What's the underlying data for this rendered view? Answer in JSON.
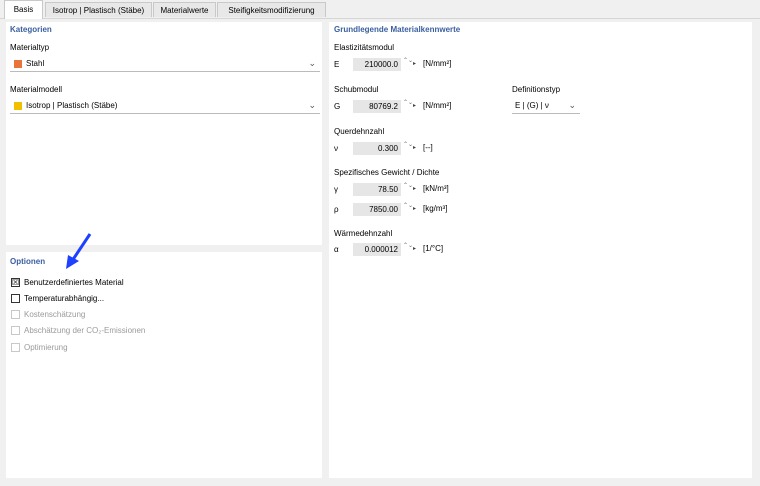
{
  "tabs": [
    "Basis",
    "Isotrop | Plastisch (Stäbe)",
    "Materialwerte",
    "Steifigkeitsmodifizierung"
  ],
  "kategorien": {
    "title": "Kategorien",
    "materialtyp_label": "Materialtyp",
    "materialtyp_value": "Stahl",
    "materialtyp_color": "#e8743b",
    "materialmodell_label": "Materialmodell",
    "materialmodell_value": "Isotrop | Plastisch (Stäbe)",
    "materialmodell_color": "#f0c000"
  },
  "optionen": {
    "title": "Optionen",
    "items": [
      {
        "label": "Benutzerdefiniertes Material",
        "checked": "☒",
        "enabled": true
      },
      {
        "label": "Temperaturabhängig...",
        "checked": "",
        "enabled": true
      },
      {
        "label": "Kostenschätzung",
        "checked": "",
        "enabled": false
      },
      {
        "label": "Abschätzung der CO₂-Emissionen",
        "checked": "",
        "enabled": false
      },
      {
        "label": "Optimierung",
        "checked": "",
        "enabled": false
      }
    ]
  },
  "grund": {
    "title": "Grundlegende Materialkennwerte",
    "e_section": "Elastizitätsmodul",
    "e_sym": "E",
    "e_val": "210000.0",
    "e_unit": "[N/mm²]",
    "g_section": "Schubmodul",
    "g_sym": "G",
    "g_val": "80769.2",
    "g_unit": "[N/mm²]",
    "def_label": "Definitionstyp",
    "def_value": "E | (G) | ν",
    "nu_section": "Querdehnzahl",
    "nu_sym": "ν",
    "nu_val": "0.300",
    "nu_unit": "[--]",
    "gamma_section": "Spezifisches Gewicht / Dichte",
    "gamma_sym": "γ",
    "gamma_val": "78.50",
    "gamma_unit": "[kN/m³]",
    "rho_sym": "ρ",
    "rho_val": "7850.00",
    "rho_unit": "[kg/m³]",
    "alpha_section": "Wärmedehnzahl",
    "alpha_sym": "α",
    "alpha_val": "0.000012",
    "alpha_unit": "[1/°C]"
  },
  "icons": {
    "spinner": "spinner-icon",
    "arrow": "arrow-right-icon",
    "chevron": "chevron-down-icon",
    "pointer": "blue-arrow-annotation-icon"
  },
  "glyphs": {
    "spin": "⌃⌄",
    "arrow": "▸",
    "chevron": "⌄"
  }
}
